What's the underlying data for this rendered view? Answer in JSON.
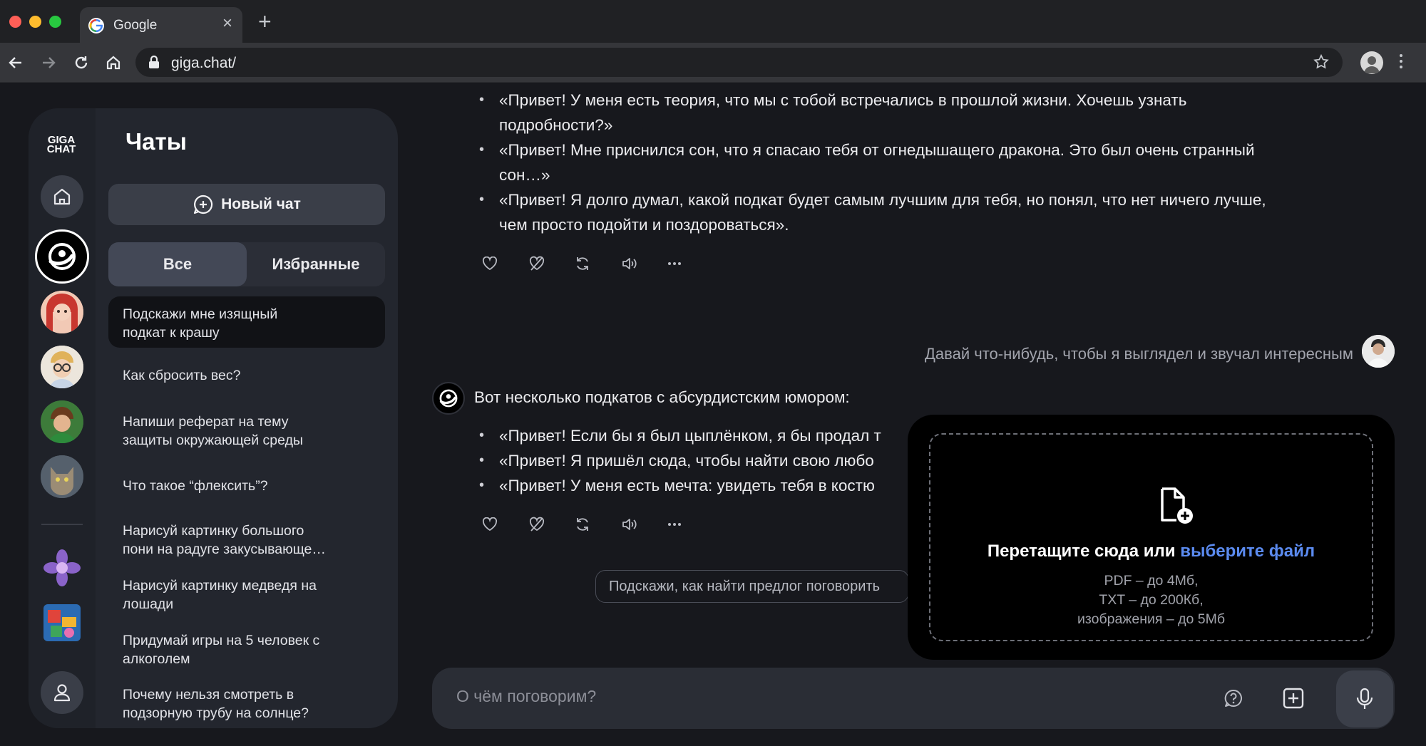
{
  "browser": {
    "tab_title": "Google",
    "tab_close": "×",
    "new_tab": "+",
    "url": "giga.chat/"
  },
  "sidebar": {
    "logo_line1": "GIGA",
    "logo_line2": "CHAT",
    "title": "Чаты",
    "new_chat_label": "Новый чат",
    "filters": [
      "Все",
      "Избранные"
    ],
    "active_filter": "Все",
    "chats": [
      {
        "line1": "Подскажи мне изящный",
        "line2": "подкат к крашу",
        "active": true
      },
      {
        "line1": "Как сбросить вес?",
        "line2": ""
      },
      {
        "line1": "Напиши реферат на тему",
        "line2": "защиты окружающей среды"
      },
      {
        "line1": "Что такое “флексить”?",
        "line2": ""
      },
      {
        "line1": "Нарисуй картинку большого",
        "line2": "пони на радуге закусывающе…"
      },
      {
        "line1": "Нарисуй картинку медведя на",
        "line2": "лошади"
      },
      {
        "line1": "Придумай игры на 5 человек с",
        "line2": "алкоголем"
      },
      {
        "line1": "Почему нельзя смотреть в",
        "line2": "подзорную трубу на солнце?"
      }
    ],
    "rail_icons": [
      "home-icon",
      "gigachat-logo-icon",
      "avatar-red-hair",
      "avatar-glasses",
      "avatar-green",
      "avatar-cat",
      "avatar-flower",
      "avatar-colorful",
      "user-profile-icon"
    ]
  },
  "conversation": {
    "first_answer_bullets": [
      [
        "«Привет! У меня есть теория, что мы с тобой встречались в прошлой жизни. Хочешь узнать",
        "подробности?»"
      ],
      [
        "«Привет! Мне приснился сон, что я спасаю тебя от огнедышащего дракона. Это был очень странный",
        "сон…»"
      ],
      [
        "«Привет! Я долго думал, какой подкат будет самым лучшим для тебя, но понял, что нет ничего лучше,",
        "чем просто подойти и поздороваться»."
      ]
    ],
    "user_message": "Давай что-нибудь, чтобы я выглядел и звучал интересным",
    "bot_intro": "Вот несколько подкатов с абсурдистским юмором:",
    "second_answer_bullets": [
      "«Привет! Если бы я был цыплёнком, я бы продал т",
      "«Привет! Я пришёл сюда, чтобы найти свою любо",
      "«Привет! У меня есть мечта: увидеть тебя в костю"
    ],
    "action_icons": [
      "like-icon",
      "dislike-icon",
      "regenerate-icon",
      "speaker-icon",
      "more-icon"
    ],
    "suggestion": "Подскажи, как найти предлог поговорить"
  },
  "dropzone": {
    "title_prefix": "Перетащите сюда или ",
    "title_link": "выберите файл",
    "limits": [
      "PDF – до 4Мб,",
      "TXT – до 200Кб,",
      "изображения – до 5Мб"
    ]
  },
  "composer": {
    "placeholder": "О чём поговорим?"
  },
  "colors": {
    "background": "#17181d",
    "panel": "#23262e",
    "accent_link": "#5b8bf0",
    "dropzone_bg": "#000000"
  }
}
